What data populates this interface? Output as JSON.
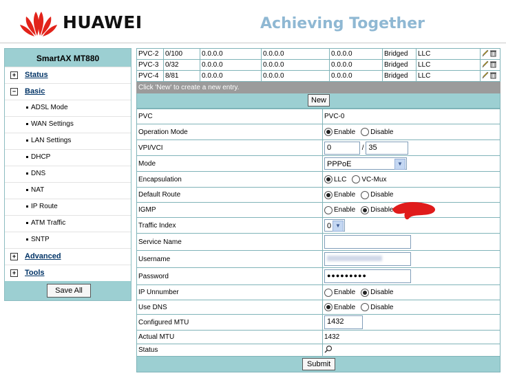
{
  "header": {
    "brand": "HUAWEI",
    "tagline": "Achieving Together"
  },
  "sidebar": {
    "title": "SmartAX MT880",
    "items": [
      {
        "label": "Status",
        "type": "top",
        "box": "+"
      },
      {
        "label": "Basic",
        "type": "top",
        "box": "−"
      },
      {
        "label": "ADSL Mode",
        "type": "sub"
      },
      {
        "label": "WAN Settings",
        "type": "sub"
      },
      {
        "label": "LAN Settings",
        "type": "sub"
      },
      {
        "label": "DHCP",
        "type": "sub"
      },
      {
        "label": "DNS",
        "type": "sub"
      },
      {
        "label": "NAT",
        "type": "sub"
      },
      {
        "label": "IP Route",
        "type": "sub"
      },
      {
        "label": "ATM Traffic",
        "type": "sub"
      },
      {
        "label": "SNTP",
        "type": "sub"
      },
      {
        "label": "Advanced",
        "type": "top",
        "box": "+"
      },
      {
        "label": "Tools",
        "type": "top",
        "box": "+"
      }
    ],
    "save_all": "Save All"
  },
  "pvc_rows": [
    {
      "pvc": "PVC-2",
      "vpivci": "0/100",
      "ip1": "0.0.0.0",
      "ip2": "0.0.0.0",
      "ip3": "0.0.0.0",
      "mode": "Bridged",
      "encap": "LLC"
    },
    {
      "pvc": "PVC-3",
      "vpivci": "0/32",
      "ip1": "0.0.0.0",
      "ip2": "0.0.0.0",
      "ip3": "0.0.0.0",
      "mode": "Bridged",
      "encap": "LLC"
    },
    {
      "pvc": "PVC-4",
      "vpivci": "8/81",
      "ip1": "0.0.0.0",
      "ip2": "0.0.0.0",
      "ip3": "0.0.0.0",
      "mode": "Bridged",
      "encap": "LLC"
    }
  ],
  "notice": "Click 'New' to create a new entry.",
  "new_button": "New",
  "form": {
    "pvc_label": "PVC",
    "pvc_value": "PVC-0",
    "op_mode_label": "Operation Mode",
    "enable": "Enable",
    "disable": "Disable",
    "vpivci_label": "VPI/VCI",
    "vpi": "0",
    "vci_sep": "/",
    "vci": "35",
    "mode_label": "Mode",
    "mode_value": "PPPoE",
    "encap_label": "Encapsulation",
    "llc": "LLC",
    "vcmux": "VC-Mux",
    "default_route_label": "Default Route",
    "igmp_label": "IGMP",
    "traffic_index_label": "Traffic Index",
    "traffic_index": "0",
    "service_name_label": "Service Name",
    "service_name": "",
    "username_label": "Username",
    "password_label": "Password",
    "password": "●●●●●●●●●",
    "ip_unnumber_label": "IP Unnumber",
    "use_dns_label": "Use DNS",
    "cfg_mtu_label": "Configured MTU",
    "cfg_mtu": "1432",
    "actual_mtu_label": "Actual MTU",
    "actual_mtu": "1432",
    "status_label": "Status"
  },
  "submit": "Submit",
  "colors": {
    "bar": "#9ccfd2",
    "notice": "#9b9b9b",
    "tagline": "#8fb8d3",
    "logo": "#e2231a"
  }
}
